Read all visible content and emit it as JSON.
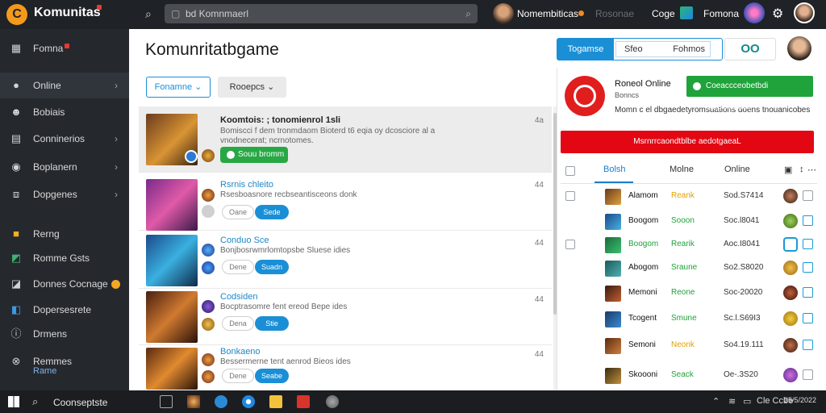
{
  "topbar": {
    "logo_letter": "C",
    "logo_text": "Komunitas",
    "search_text": "bd Komnmaerl",
    "user_name": "Nomembiticas",
    "user_sub": "Rosonae",
    "code": "Coge",
    "forum": "Fomona"
  },
  "sidebar": {
    "items": [
      {
        "label": "Fomna",
        "icon": "grid-icon"
      },
      {
        "label": "Online",
        "icon": "online-icon"
      },
      {
        "label": "Bobiais",
        "icon": "people-icon"
      },
      {
        "label": "Conninerios",
        "icon": "document-icon"
      },
      {
        "label": "Boplanern",
        "icon": "compass-icon"
      },
      {
        "label": "Dopgenes",
        "icon": "box-icon"
      },
      {
        "label": "Rerng",
        "icon": "folder-icon"
      },
      {
        "label": "Romme Gsts",
        "icon": "chart-icon"
      },
      {
        "label": "Donnes Cocnage",
        "icon": "image-icon"
      },
      {
        "label": "Dopersesrete",
        "icon": "map-icon"
      },
      {
        "label": "Drmens",
        "icon": "info-icon"
      },
      {
        "label": "Remmes",
        "icon": "close-icon"
      }
    ],
    "last_sub": "Rame"
  },
  "main": {
    "title": "Komunritatbgame",
    "tabs": {
      "active": "Togamse",
      "middle": "Sfeo",
      "right": "Fohmos"
    },
    "oo": "OO",
    "filter1": "Fonamne",
    "filter2": "Rooepcs"
  },
  "cards": [
    {
      "title": "Koomtois: ; tonomienrol 1sli",
      "desc": "Bomiscci f dem tronmdaom Bioterd t6 eqia oy dcosciore al a vnodnecerat; ncrnotomes.",
      "num": "4a",
      "green_label": "Souu bromm"
    },
    {
      "title": "Rsrnis chleito",
      "desc": "Rsesboasnore recbseantisceons donk",
      "num": "44",
      "pill1": "Oane",
      "pill2": "Sede"
    },
    {
      "title": "Conduo Sce",
      "desc": "Bonjbosrwmrlomtopsbe Sluese idies",
      "num": "44",
      "pill1": "Dene",
      "pill2": "Suadn"
    },
    {
      "title": "Codsiden",
      "desc": "Bocptrasomre fent ereod Bepe ides",
      "num": "44",
      "pill1": "Dena",
      "pill2": "Stie"
    },
    {
      "title": "Bonkaeno",
      "desc": "Bessermerne tent aenrod Bieos ides",
      "num": "44",
      "pill1": "Dene",
      "pill2": "Seabe"
    }
  ],
  "panel": {
    "title": "Roneol Online",
    "sub": "Bonncs",
    "desc": "Momn c el dbgaedetyromsuations doens tnouanicobes",
    "green": "Coeaccceobetbdi emplaiceaes",
    "red": "Msrnrrcaondtblbe aedotgaeaL",
    "tabs": [
      "Bolsh",
      "Molne",
      "Online"
    ]
  },
  "rows": [
    {
      "name": "Alamom",
      "status": "Reank",
      "status_color": "#e0a000",
      "score": "Sod.S7414"
    },
    {
      "name": "Boogom",
      "status": "Sooon",
      "status_color": "#1fa33a",
      "score": "Soc.l8041"
    },
    {
      "name": "Boogom",
      "status": "Rearik",
      "status_color": "#1fa33a",
      "score": "Aoc.I8041"
    },
    {
      "name": "Abogom",
      "status": "Sraune",
      "status_color": "#1fa33a",
      "score": "So2.S8020"
    },
    {
      "name": "Memoni",
      "status": "Reone",
      "status_color": "#1fa33a",
      "score": "Soc-20020"
    },
    {
      "name": "Tcogent",
      "status": "Smune",
      "status_color": "#1fa33a",
      "score": "Sc.l.S69I3"
    },
    {
      "name": "Semoni",
      "status": "Neonk",
      "status_color": "#e0a000",
      "score": "So4.19.111"
    },
    {
      "name": "Skoooni",
      "status": "Seack",
      "status_color": "#1fa33a",
      "score": "Oe-.3S20"
    }
  ],
  "taskbar": {
    "search_text": "Coonseptste",
    "tray": "Cle Ccbe",
    "time": "25/5/2022"
  }
}
